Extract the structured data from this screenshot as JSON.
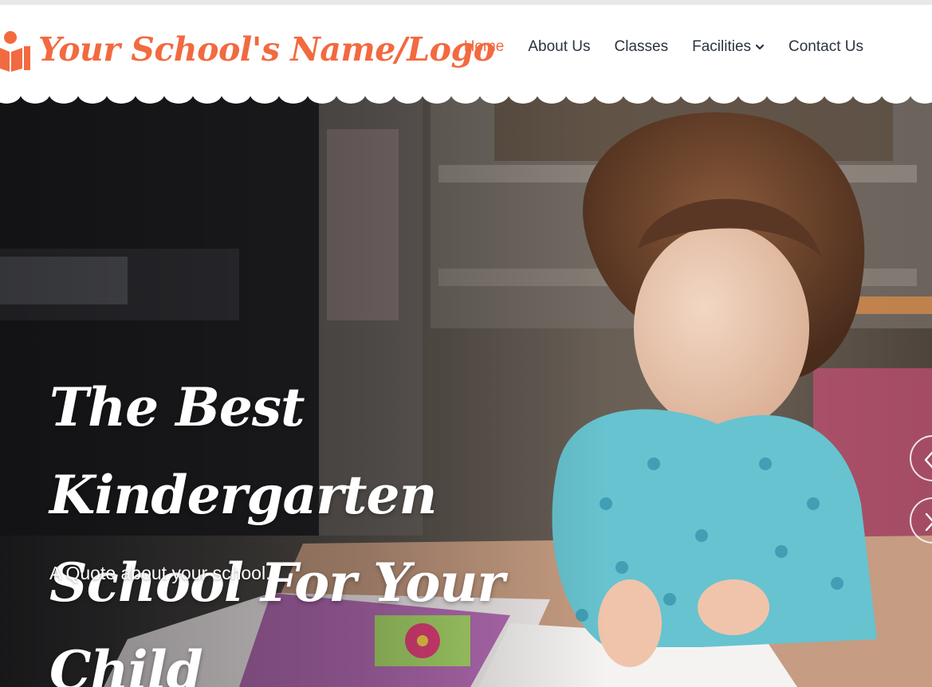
{
  "brand": {
    "name": "Your School's Name/Logo",
    "icon": "reading-person-icon",
    "color": "#f26a3f"
  },
  "nav": {
    "items": [
      {
        "label": "Home",
        "active": true
      },
      {
        "label": "About Us"
      },
      {
        "label": "Classes"
      },
      {
        "label": "Facilities",
        "has_dropdown": true
      },
      {
        "label": "Contact Us"
      }
    ]
  },
  "hero": {
    "title_line1": "The Best Kindergarten",
    "title_line2": "School For Your Child",
    "quote": "A Quote about your school.",
    "prev_icon": "chevron-left-icon",
    "next_icon": "chevron-right-icon"
  },
  "colors": {
    "accent": "#f26a3f",
    "nav_text": "#2c3440",
    "hero_text": "#ffffff"
  }
}
